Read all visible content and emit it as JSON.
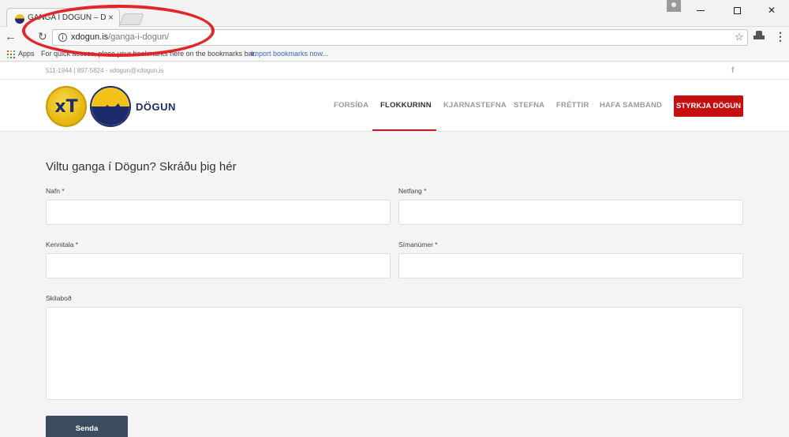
{
  "browser": {
    "tab_title": "GANGA Í DÖGUN – Dögun",
    "tab_close": "×",
    "url_host": "xdogun.is",
    "url_path": "/ganga-i-dogun/",
    "bookmarks": {
      "apps_label": "Apps",
      "message": "For quick access, place your bookmarks here on the bookmarks bar.",
      "import_link": "Import bookmarks now..."
    },
    "apps_colors": [
      "#e8453c",
      "#f4b400",
      "#3c8cf0",
      "#0f9d58",
      "#e8453c",
      "#3c8cf0",
      "#f4b400",
      "#0f9d58",
      "#e8453c"
    ]
  },
  "site": {
    "contact": "511-1944 | 897-5624 - xdogun@xdogun.is",
    "logo_xt": "xT",
    "logo_word": "DÖGUN",
    "nav": [
      {
        "label": "FORSÍÐA",
        "active": false
      },
      {
        "label": "FLOKKURINN",
        "active": true
      },
      {
        "label": "KJARNASTEFNA",
        "active": false
      },
      {
        "label": "STEFNA",
        "active": false
      },
      {
        "label": "FRÉTTIR",
        "active": false
      },
      {
        "label": "HAFA SAMBAND",
        "active": false
      }
    ],
    "cta_label": "STYRKJA DÖGUN",
    "accent_color": "#c60f0f"
  },
  "form": {
    "title": "Viltu ganga í Dögun? Skráðu þig hér",
    "name_label": "Nafn *",
    "email_label": "Netfang *",
    "kennitala_label": "Kennitala *",
    "phone_label": "Símanúmer *",
    "message_label": "Skilaboð",
    "submit_label": "Senda"
  }
}
